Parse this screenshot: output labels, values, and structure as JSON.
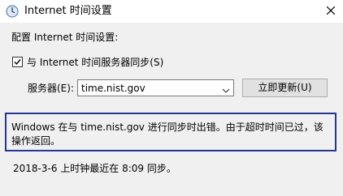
{
  "window": {
    "title": "Internet 时间设置"
  },
  "section_label": "配置 Internet 时间设置:",
  "sync": {
    "checkbox_label": "与 Internet 时间服务器同步(S)",
    "checked": true
  },
  "server": {
    "label": "服务器(E):",
    "value": "time.nist.gov"
  },
  "update_button_label": "立即更新(U)",
  "error_message": "Windows 在与 time.nist.gov 进行同步时出错。由于超时时间已过，该操作返回。",
  "last_sync_text": "2018-3-6 上时钟最近在 8:09 同步。",
  "colors": {
    "error_border": "#27378f",
    "window_bg": "#f0f0f0",
    "titlebar_bg": "#ffffff"
  },
  "icons": {
    "title": "clock-globe-icon",
    "close": "close-icon",
    "combo_arrow": "chevron-down-icon",
    "checkmark": "checkmark-icon"
  }
}
